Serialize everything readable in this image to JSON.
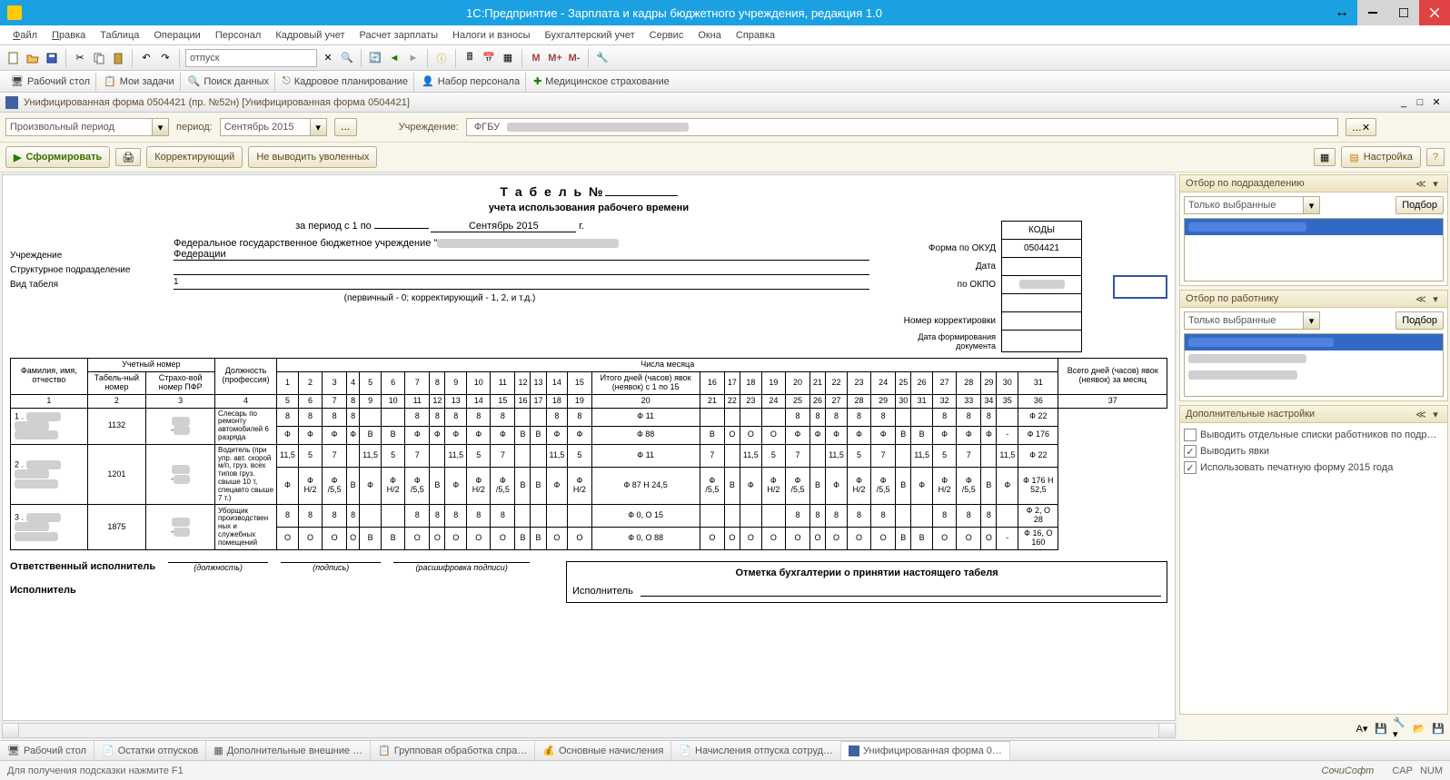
{
  "window": {
    "title": "1С:Предприятие - Зарплата и кадры бюджетного учреждения, редакция 1.0"
  },
  "menu": [
    "Файл",
    "Правка",
    "Таблица",
    "Операции",
    "Персонал",
    "Кадровый учет",
    "Расчет зарплаты",
    "Налоги и взносы",
    "Бухгалтерский учет",
    "Сервис",
    "Окна",
    "Справка"
  ],
  "search_input": "отпуск",
  "toolbar_letters": [
    "M",
    "M+",
    "M-"
  ],
  "nav": [
    {
      "label": "Рабочий стол"
    },
    {
      "label": "Мои задачи"
    },
    {
      "label": "Поиск данных"
    },
    {
      "label": "Кадровое планирование"
    },
    {
      "label": "Набор персонала"
    },
    {
      "label": "Медицинское страхование"
    }
  ],
  "form": {
    "title": "Унифицированная форма 0504421 (пр. №52н) [Унифицированная форма 0504421]",
    "period_type": "Произвольный период",
    "period_lbl": "период:",
    "period_val": "Сентябрь 2015",
    "org_lbl": "Учреждение:",
    "org_val": "ФГБУ",
    "btn_form": "Сформировать",
    "btn_corr": "Корректирующий",
    "chk_nofired": "Не выводить уволенных",
    "btn_settings": "Настройка"
  },
  "report": {
    "title1": "Т а б е л ь №",
    "title2": "учета использования рабочего времени",
    "period": {
      "pre": "за период с 1 по",
      "mid": "Сентябрь 2015",
      "suf": "г."
    },
    "rows_lbl": [
      "Учреждение",
      "Структурное подразделение",
      "Вид табеля"
    ],
    "org_long": "Федеральное государственное бюджетное учреждение \"",
    "org_long2": "Федерации",
    "type_val": "1",
    "type_note": "(первичный - 0; корректирующий - 1, 2, и т.д.)",
    "codes_hdr": "КОДЫ",
    "codes": [
      {
        "lbl": "Форма по ОКУД",
        "val": "0504421"
      },
      {
        "lbl": "Дата",
        "val": ""
      },
      {
        "lbl": "по ОКПО",
        "val": ""
      },
      {
        "lbl": "",
        "val": ""
      },
      {
        "lbl": "Номер корректировки",
        "val": ""
      },
      {
        "lbl": "Дата формирования документа",
        "val": ""
      }
    ],
    "col_hdrs": {
      "c1": "Фамилия, имя, отчество",
      "c2": "Учетный номер",
      "c2a": "Табель-ный номер",
      "c2b": "Страхо-вой номер ПФР",
      "c3": "Должность (профессия)",
      "days": "Числа месяца",
      "c20": "Итого дней (часов) явок (неявок) с 1 по 15",
      "c37": "Всего дней (часов) явок (неявок) за месяц"
    },
    "day_nums": [
      "1",
      "2",
      "3",
      "4",
      "5",
      "6",
      "7",
      "8",
      "9",
      "10",
      "11",
      "12",
      "13",
      "14",
      "15",
      "16",
      "17",
      "18",
      "19",
      "20",
      "21",
      "22",
      "23",
      "24",
      "25",
      "26",
      "27",
      "28",
      "29",
      "30",
      "31"
    ],
    "col_nums": [
      "1",
      "2",
      "3",
      "4",
      "5",
      "6",
      "7",
      "8",
      "9",
      "10",
      "11",
      "12",
      "13",
      "14",
      "15",
      "16",
      "17",
      "18",
      "19",
      "20",
      "21",
      "22",
      "23",
      "24",
      "25",
      "26",
      "27",
      "28",
      "29",
      "30",
      "31",
      "32",
      "33",
      "34",
      "35",
      "36",
      "37"
    ],
    "rows": [
      {
        "n": "1",
        "name": "",
        "tab": "1132",
        "pfr": "",
        "pos": "Слесарь по ремонту автомобилей 6 разряда",
        "r1": [
          "8",
          "8",
          "8",
          "8",
          "",
          "",
          "8",
          "8",
          "8",
          "8",
          "8",
          "",
          "",
          "8",
          "8",
          "Ф 11",
          "",
          "",
          "",
          "",
          "8",
          "8",
          "8",
          "8",
          "8",
          "",
          "",
          "8",
          "8",
          "8",
          "",
          "Ф 22"
        ],
        "r2": [
          "Ф",
          "Ф",
          "Ф",
          "Ф",
          "В",
          "В",
          "Ф",
          "Ф",
          "Ф",
          "Ф",
          "Ф",
          "В",
          "В",
          "Ф",
          "Ф",
          "Ф 88",
          "В",
          "О",
          "О",
          "О",
          "Ф",
          "Ф",
          "Ф",
          "Ф",
          "Ф",
          "В",
          "В",
          "Ф",
          "Ф",
          "Ф",
          "-",
          "Ф 176"
        ]
      },
      {
        "n": "2",
        "name": "",
        "tab": "1201",
        "pfr": "",
        "pos": "Водитель (при упр. авт. скорой м/п, груз. всех типов груз. свыше 10 т, спецавто свыше 7 т.)",
        "r1": [
          "11,5",
          "5",
          "7",
          "",
          "11,5",
          "5",
          "7",
          "",
          "11,5",
          "5",
          "7",
          "",
          "",
          "11,5",
          "5",
          "Ф 11",
          "7",
          "",
          "11,5",
          "5",
          "7",
          "",
          "11,5",
          "5",
          "7",
          "",
          "11,5",
          "5",
          "7",
          "",
          "11,5",
          "Ф 22"
        ],
        "r2": [
          "Ф",
          "Ф Н/2",
          "Ф /5,5",
          "В",
          "Ф",
          "Ф Н/2",
          "Ф /5,5",
          "В",
          "Ф",
          "Ф Н/2",
          "Ф /5,5",
          "В",
          "В",
          "Ф",
          "Ф Н/2",
          "Ф 87 Н 24,5",
          "Ф /5,5",
          "В",
          "Ф",
          "Ф Н/2",
          "Ф /5,5",
          "В",
          "Ф",
          "Ф Н/2",
          "Ф /5,5",
          "В",
          "Ф",
          "Ф Н/2",
          "Ф /5,5",
          "В",
          "Ф",
          "Ф 176 Н 52,5"
        ]
      },
      {
        "n": "3",
        "name": "",
        "tab": "1875",
        "pfr": "",
        "pos": "Уборщик производствен ных и служебных помещений",
        "r1": [
          "8",
          "8",
          "8",
          "8",
          "",
          "",
          "8",
          "8",
          "8",
          "8",
          "8",
          "",
          "",
          "",
          "",
          "Ф 0, О 15",
          "",
          "",
          "",
          "",
          "8",
          "8",
          "8",
          "8",
          "8",
          "",
          "",
          "8",
          "8",
          "8",
          "",
          "Ф 2, О 28"
        ],
        "r2": [
          "О",
          "О",
          "О",
          "О",
          "В",
          "В",
          "О",
          "О",
          "О",
          "О",
          "О",
          "В",
          "В",
          "О",
          "О",
          "Ф 0, О 88",
          "О",
          "О",
          "О",
          "О",
          "О",
          "О",
          "О",
          "О",
          "О",
          "В",
          "В",
          "О",
          "О",
          "О",
          "-",
          "Ф 16, О 160"
        ]
      }
    ],
    "sig": {
      "resp": "Ответственный исполнитель",
      "exec": "Исполнитель",
      "pos": "(должность)",
      "sign": "(подпись)",
      "name": "(расшифровка подписи)",
      "acct_title": "Отметка бухгалтерии о принятии настоящего табеля",
      "acct_exec": "Исполнитель"
    }
  },
  "side": {
    "p1": {
      "title": "Отбор по подразделению",
      "combo": "Только выбранные",
      "btn": "Подбор"
    },
    "p2": {
      "title": "Отбор по работнику",
      "combo": "Только выбранные",
      "btn": "Подбор"
    },
    "p3": {
      "title": "Дополнительные настройки",
      "c1": "Выводить отдельные списки работников по подр…",
      "c2": "Выводить явки",
      "c3": "Использовать печатную форму 2015 года"
    }
  },
  "bottom_tabs": [
    "Рабочий стол",
    "Остатки отпусков",
    "Дополнительные внешние …",
    "Групповая обработка спра…",
    "Основные начисления",
    "Начисления отпуска сотруд…",
    "Унифицированная форма 0…"
  ],
  "status": {
    "hint": "Для получения подсказки нажмите F1",
    "brand": "СочиСофт",
    "caps": "CAP",
    "num": "NUM"
  }
}
